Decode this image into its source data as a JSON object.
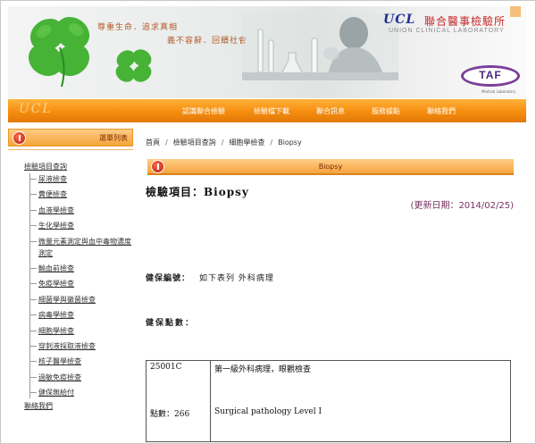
{
  "header": {
    "slogan_line1": "尊重生命．追求真相",
    "slogan_line2": "義不容辭．回饋社會",
    "brand_ucl": "UCL",
    "brand_zh": "聯合醫事檢驗所",
    "brand_en": "UNION CLINICAL LABORATORY",
    "taf_label": "TAF",
    "taf_sub": "Medical Laboratory"
  },
  "nav": {
    "logo": "UCL",
    "items": [
      {
        "label": "認識聯合檢驗"
      },
      {
        "label": "檢驗檔下載"
      },
      {
        "label": "聯合訊息"
      },
      {
        "label": "服務據點"
      },
      {
        "label": "聯絡我們"
      }
    ]
  },
  "sidebar": {
    "title": "選單列表",
    "root_label": "檢驗項目查詢",
    "items": [
      {
        "label": "尿液檢查"
      },
      {
        "label": "糞便檢查"
      },
      {
        "label": "血液學檢查"
      },
      {
        "label": "生化學檢查"
      },
      {
        "label": "微量元素測定與血中毒物濃度測定"
      },
      {
        "label": "輸血前檢查"
      },
      {
        "label": "免疫學檢查"
      },
      {
        "label": "細菌學與黴菌檢查"
      },
      {
        "label": "病毒學檢查"
      },
      {
        "label": "細胞學檢查"
      },
      {
        "label": "穿刺液採取液檢查"
      },
      {
        "label": "核子醫學檢查"
      },
      {
        "label": "過敏免疫檢查"
      },
      {
        "label": "健保無給付"
      }
    ],
    "contact_label": "聯絡我們"
  },
  "breadcrumb": {
    "items": [
      "首頁",
      "檢驗項目查詢",
      "細胞學檢查",
      "Biopsy"
    ]
  },
  "section": {
    "title": "Biopsy"
  },
  "item": {
    "title_label": "檢驗項目：",
    "title_value": "Biopsy",
    "updated": "(更新日期：2014/02/25)",
    "nhi_code_label": "健保編號：",
    "nhi_code_value": "如下表列 外科病理",
    "nhi_points_label": "健保點數："
  },
  "fee_table": {
    "rows": [
      {
        "code": "25001C",
        "points": "點數：266",
        "name_zh": "第一級外科病理，眼觀檢查",
        "name_en": "Surgical pathology Level I"
      }
    ]
  },
  "colors": {
    "nav_orange": "#f58d0e",
    "accent_red": "#c62828",
    "brand_blue": "#1e2f8f",
    "taf_purple": "#7b3f9a",
    "updated_text": "#7a3060"
  }
}
